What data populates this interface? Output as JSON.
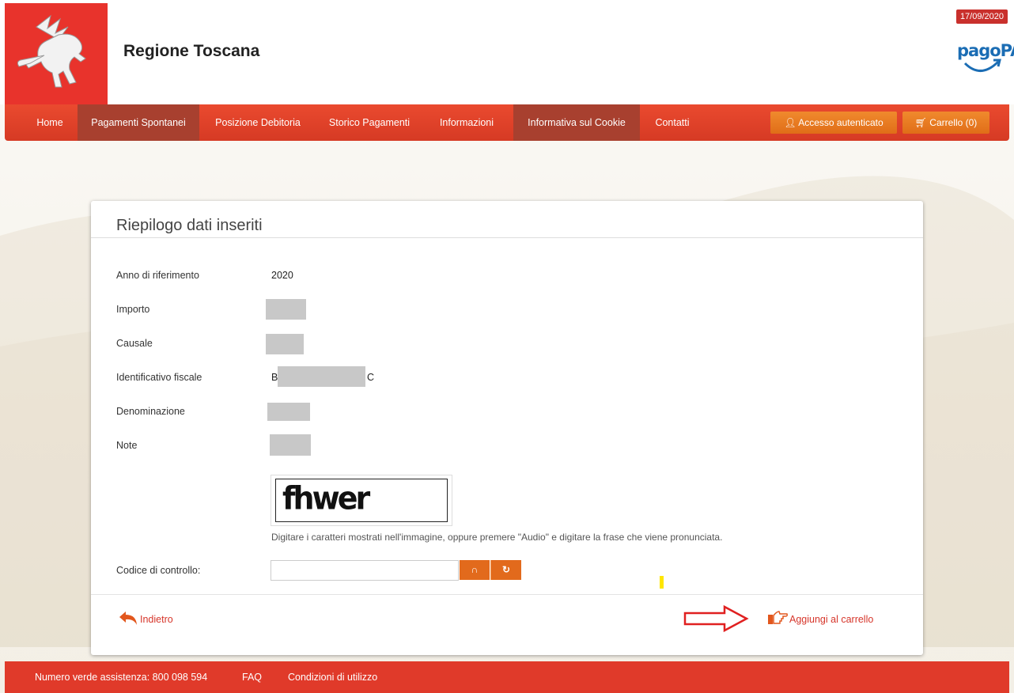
{
  "header": {
    "title": "Regione Toscana",
    "date": "17/09/2020",
    "pagopa_label": "pagoPA",
    "logo_icon": "winged-horse-icon"
  },
  "nav": {
    "items": [
      "Home",
      "Pagamenti Spontanei",
      "Posizione Debitoria",
      "Storico Pagamenti",
      "Informazioni",
      "Informativa sul Cookie",
      "Contatti"
    ],
    "active": [
      "Pagamenti Spontanei",
      "Informativa sul Cookie"
    ],
    "login_label": "Accesso autenticato",
    "cart_label": "Carrello (0)"
  },
  "summary": {
    "title": "Riepilogo dati inseriti",
    "fields": [
      {
        "label": "Anno di riferimento",
        "value": "2020"
      },
      {
        "label": "Importo",
        "value": ""
      },
      {
        "label": "Causale",
        "value": ""
      },
      {
        "label": "Identificativo fiscale",
        "value_prefix": "B",
        "value_suffix": "C"
      },
      {
        "label": "Denominazione",
        "value": ""
      },
      {
        "label": "Note",
        "value": ""
      }
    ],
    "captcha_text": "fhwer",
    "captcha_hint": "Digitare i caratteri mostrati nell'immagine, oppure premere \"Audio\" e digitare la frase che viene pronunciata.",
    "code_label": "Codice di controllo:",
    "code_value": "",
    "back_label": "Indietro",
    "add_label": "Aggiungi al carrello"
  },
  "footer": {
    "phone": "Numero verde assistenza: 800 098 594",
    "faq": "FAQ",
    "terms": "Condizioni di utilizzo"
  },
  "colors": {
    "brand_red": "#e03a2a",
    "orange": "#e26a1c",
    "active_nav": "#a8402f"
  }
}
